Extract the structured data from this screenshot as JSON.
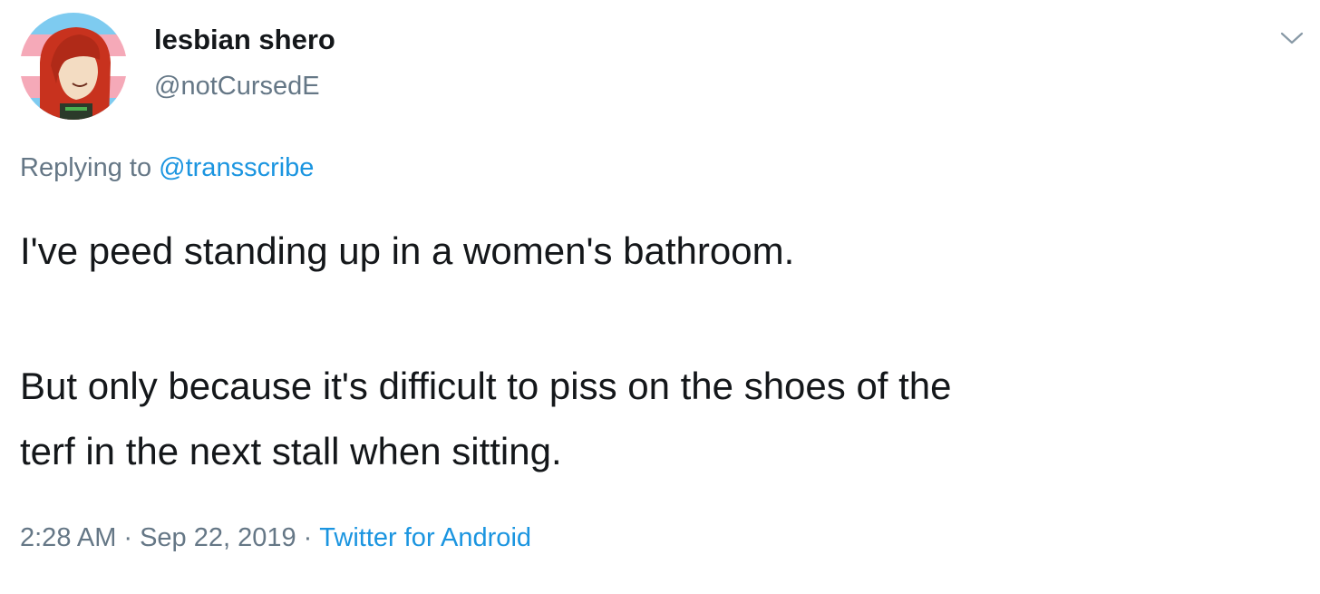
{
  "author": {
    "display_name": "lesbian shero",
    "handle": "@notCursedE"
  },
  "reply": {
    "prefix": "Replying to ",
    "mention": "@transscribe"
  },
  "tweet": {
    "line1": "I've peed standing up in a women's bathroom.",
    "line2": "But only because it's difficult to piss on the shoes of the",
    "line3": "terf in the next stall when sitting."
  },
  "meta": {
    "time": "2:28 AM",
    "separator": "·",
    "date": "Sep 22, 2019",
    "source": "Twitter for Android"
  },
  "icons": {
    "more": "chevron-down-icon"
  },
  "colors": {
    "link": "#1b95e0",
    "secondary": "#657786",
    "text": "#14171a"
  }
}
